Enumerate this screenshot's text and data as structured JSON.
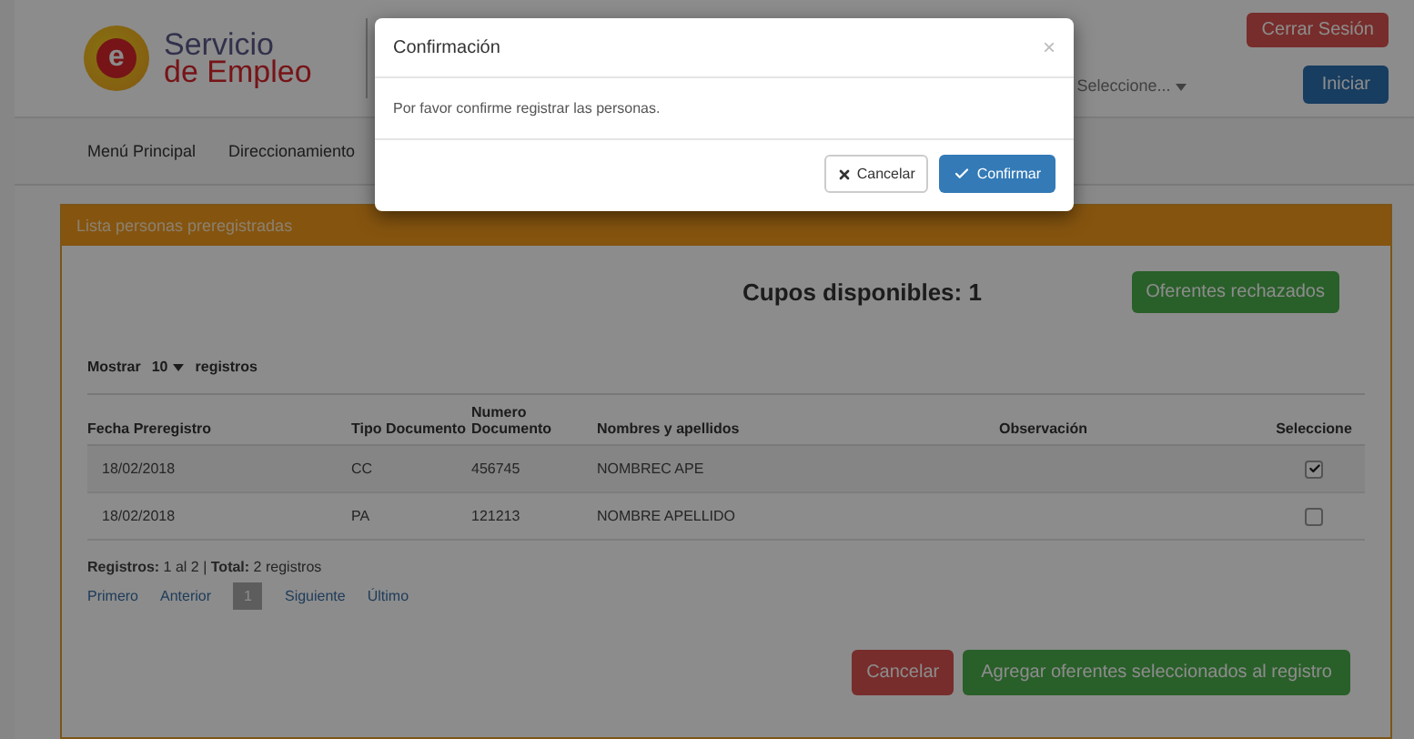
{
  "header": {
    "logo_mark": "e",
    "logo_line1": "Servicio",
    "logo_line2": "de Empleo",
    "logout_button": "Cerrar Sesión",
    "role_select": {
      "value": "Seleccione..."
    },
    "login_button": "Iniciar"
  },
  "nav": {
    "items": [
      {
        "label": "Menú Principal"
      },
      {
        "label": "Direccionamiento"
      }
    ]
  },
  "panel": {
    "title": "Lista personas preregistradas",
    "quota": "Cupos disponibles: 1",
    "rejected_button": "Oferentes rechazados",
    "length_menu": {
      "prefix": "Mostrar",
      "value": "10",
      "suffix": "registros"
    },
    "table": {
      "columns": [
        "Fecha Preregistro",
        "Tipo Documento",
        "Numero Documento",
        "Nombres y apellidos",
        "Observación",
        "Seleccione"
      ],
      "rows": [
        {
          "date": "18/02/2018",
          "doc_type": "CC",
          "doc_number": "456745",
          "name": "NOMBREC APE",
          "checked": true
        },
        {
          "date": "18/02/2018",
          "doc_type": "PA",
          "doc_number": "121213",
          "name": "NOMBRE APELLIDO",
          "checked": false
        }
      ]
    },
    "summary": "**Registros:** 1 al 2 | **Total:** 2 registros",
    "pagination": [
      {
        "label": "Primero",
        "selected": false
      },
      {
        "label": "Anterior",
        "selected": false
      },
      {
        "label": "1",
        "selected": true
      },
      {
        "label": "Siguiente",
        "selected": false
      },
      {
        "label": "Último",
        "selected": false
      }
    ],
    "cancel_button": "Cancelar",
    "add_button": "Agregar oferentes seleccionados al registro"
  },
  "modal": {
    "title": "Confirmación",
    "close": "×",
    "message": "Por favor confirme registrar las personas.",
    "cancel_button": "Cancelar",
    "confirm_button": "Confirmar"
  }
}
